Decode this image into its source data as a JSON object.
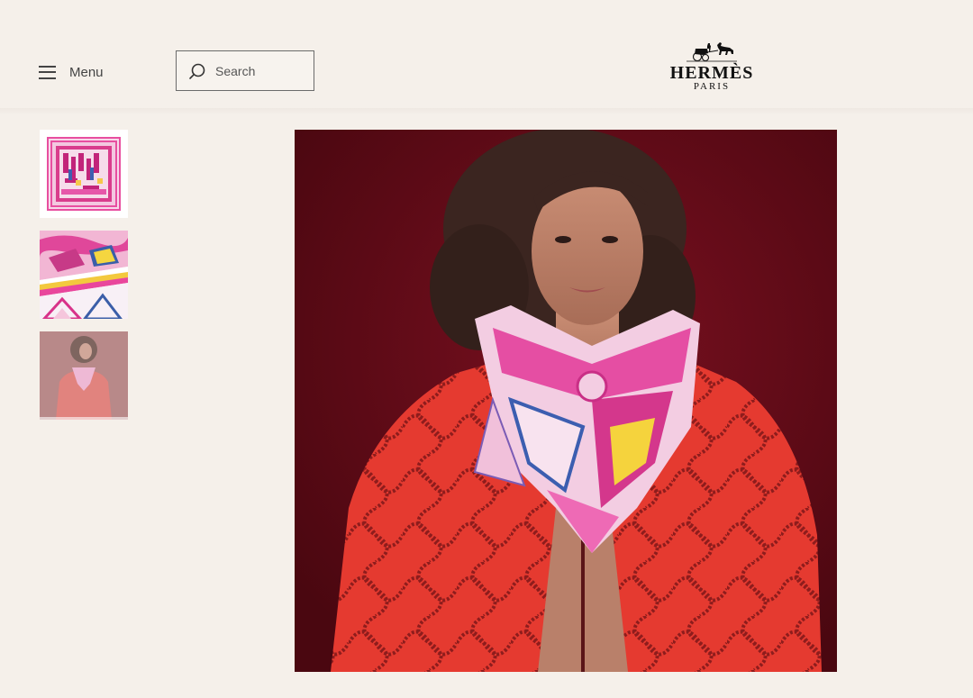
{
  "header": {
    "menu_label": "Menu",
    "search_placeholder": "Search",
    "search_value": "",
    "logo": {
      "name": "HERMÈS",
      "city": "PARIS"
    }
  },
  "gallery": {
    "thumbnails": [
      {
        "subject": "flat scarf"
      },
      {
        "subject": "scarf detail"
      },
      {
        "subject": "model wearing scarf",
        "selected": true
      }
    ],
    "main_image": {
      "subject": "model wearing silk scarf over red jacket"
    }
  },
  "colors": {
    "background": "#f5f0ea",
    "text": "#444444",
    "backdrop": "#6a0d18",
    "jacket": "#e0382e",
    "scarf_pink": "#e44fa8"
  }
}
